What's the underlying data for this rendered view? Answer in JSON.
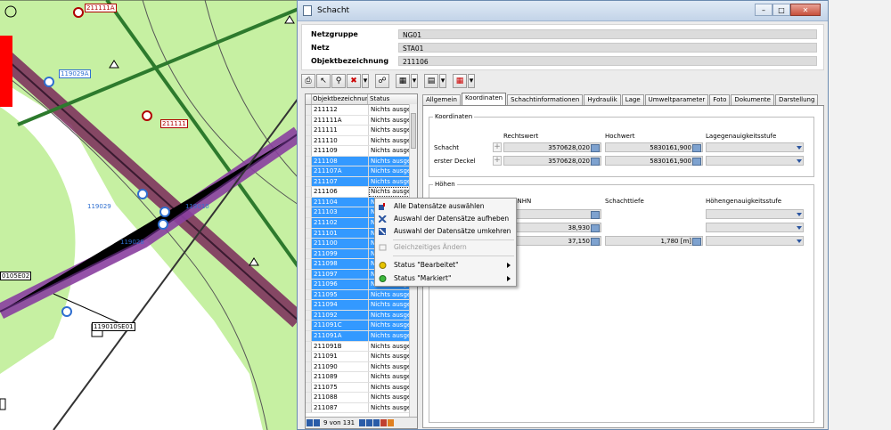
{
  "map": {
    "labels": [
      {
        "text": "211111A",
        "color": "#b00000"
      },
      {
        "text": "119029A",
        "color": "#2f6fd0"
      },
      {
        "text": "211111",
        "color": "#b00000"
      },
      {
        "text": "119029",
        "color": "#2f6fd0"
      },
      {
        "text": "119010",
        "color": "#2f6fd0"
      },
      {
        "text": "119028",
        "color": "#2f6fd0"
      },
      {
        "text": "0105E02",
        "color": "#000000"
      },
      {
        "text": "119010SE01",
        "color": "#000000"
      }
    ]
  },
  "window": {
    "title": "Schacht",
    "controls": {
      "minimize": "–",
      "maximize": "□",
      "close": "✕"
    },
    "header": {
      "fields": [
        {
          "label": "Netzgruppe",
          "value": "NG01"
        },
        {
          "label": "Netz",
          "value": "STA01"
        },
        {
          "label": "Objektbezeichnung",
          "value": "211106"
        }
      ]
    },
    "toolbar": {
      "icons": [
        "printer-icon",
        "pointer-icon",
        "search-icon",
        "delete-icon",
        "dropdown-icon",
        "link-icon",
        "save-icon",
        "dropdown-icon",
        "document-icon",
        "dropdown-icon",
        "grid-icon",
        "dropdown-icon"
      ]
    },
    "list": {
      "columns": [
        "Objektbezeichnung",
        "Status"
      ],
      "rows": [
        {
          "id": "211112",
          "status": "Nichts ausgewählt",
          "selected": false
        },
        {
          "id": "211111A",
          "status": "Nichts ausgewählt",
          "selected": false
        },
        {
          "id": "211111",
          "status": "Nichts ausgewählt",
          "selected": false
        },
        {
          "id": "211110",
          "status": "Nichts ausgewählt",
          "selected": false
        },
        {
          "id": "211109",
          "status": "Nichts ausgewählt",
          "selected": false
        },
        {
          "id": "211108",
          "status": "Nichts ausgewählt",
          "selected": true
        },
        {
          "id": "211107A",
          "status": "Nichts ausgewählt",
          "selected": true
        },
        {
          "id": "211107",
          "status": "Nichts ausgewählt",
          "selected": true
        },
        {
          "id": "211106",
          "status": "Nichts ausgewählt",
          "selected": false,
          "current": true
        },
        {
          "id": "211104",
          "status": "Nichts ausgewählt",
          "selected": true
        },
        {
          "id": "211103",
          "status": "Nichts ausgewählt",
          "selected": true
        },
        {
          "id": "211102",
          "status": "Nichts ausgewählt",
          "selected": true
        },
        {
          "id": "211101",
          "status": "Nichts ausgewählt",
          "selected": true
        },
        {
          "id": "211100",
          "status": "Nichts ausgewählt",
          "selected": true
        },
        {
          "id": "211099",
          "status": "Nichts ausgewählt",
          "selected": true
        },
        {
          "id": "211098",
          "status": "Nichts ausgewählt",
          "selected": true
        },
        {
          "id": "211097",
          "status": "Nichts ausgewählt",
          "selected": true
        },
        {
          "id": "211096",
          "status": "Nichts ausgewählt",
          "selected": true
        },
        {
          "id": "211095",
          "status": "Nichts ausgewählt",
          "selected": true
        },
        {
          "id": "211094",
          "status": "Nichts ausgewählt",
          "selected": true
        },
        {
          "id": "211092",
          "status": "Nichts ausgewählt",
          "selected": true
        },
        {
          "id": "211091C",
          "status": "Nichts ausgewählt",
          "selected": true
        },
        {
          "id": "211091A",
          "status": "Nichts ausgewählt",
          "selected": true
        },
        {
          "id": "211091B",
          "status": "Nichts ausgewählt",
          "selected": false
        },
        {
          "id": "211091",
          "status": "Nichts ausgewählt",
          "selected": false
        },
        {
          "id": "211090",
          "status": "Nichts ausgewählt",
          "selected": false
        },
        {
          "id": "211089",
          "status": "Nichts ausgewählt",
          "selected": false
        },
        {
          "id": "211075",
          "status": "Nichts ausgewählt",
          "selected": false
        },
        {
          "id": "211088",
          "status": "Nichts ausgewählt",
          "selected": false
        },
        {
          "id": "211087",
          "status": "Nichts ausgewählt",
          "selected": false
        }
      ],
      "navigator_text": "9 von 131"
    },
    "tabs": [
      "Allgemein",
      "Koordinaten",
      "Schachtinformationen",
      "Hydraulik",
      "Lage",
      "Umweltparameter",
      "Foto",
      "Dokumente",
      "Darstellung"
    ],
    "active_tab": "Koordinaten",
    "koordinaten": {
      "group_title": "Koordinaten",
      "columns": [
        "Rechtswert",
        "Hochwert",
        "Lagegenauigkeitsstufe"
      ],
      "rows": [
        {
          "label": "Schacht",
          "rechtswert": "3570628,020",
          "hochwert": "5830161,900",
          "stufe": ""
        },
        {
          "label": "erster Deckel",
          "rechtswert": "3570628,020",
          "hochwert": "5830161,900",
          "stufe": ""
        }
      ]
    },
    "hoehen": {
      "group_title": "Höhen",
      "columns": [
        "he / NHN",
        "Schachttiefe",
        "Höhengenauigkeitsstufe"
      ],
      "rows": [
        {
          "nhn": "",
          "tiefe": "",
          "stufe": ""
        },
        {
          "nhn": "38,930",
          "tiefe": "",
          "stufe": ""
        },
        {
          "nhn": "37,150",
          "tiefe": "1,780 [m]",
          "stufe": ""
        }
      ]
    },
    "context_menu": {
      "items": [
        {
          "label": "Alle Datensätze auswählen",
          "enabled": true,
          "icon": "select-all-icon"
        },
        {
          "label": "Auswahl der Datensätze aufheben",
          "enabled": true,
          "icon": "deselect-icon"
        },
        {
          "label": "Auswahl der Datensätze umkehren",
          "enabled": true,
          "icon": "invert-selection-icon"
        },
        {
          "label": "Gleichzeitiges Ändern",
          "enabled": false,
          "icon": "edit-multiple-icon"
        },
        {
          "label": "Status \"Bearbeitet\"",
          "enabled": true,
          "icon": "yellow-dot-icon",
          "submenu": true
        },
        {
          "label": "Status \"Markiert\"",
          "enabled": true,
          "icon": "green-dot-icon",
          "submenu": true
        }
      ]
    }
  }
}
